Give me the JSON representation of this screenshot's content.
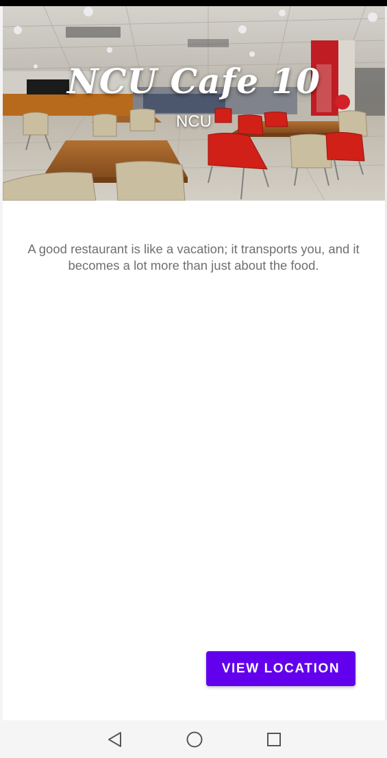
{
  "hero": {
    "title": "NCU Cafe 10",
    "subtitle": "NCU",
    "image_icon": "cafeteria-photo"
  },
  "description": "A good restaurant is like a vacation; it transports you, and it becomes a lot more than just about the food.",
  "actions": {
    "view_location_label": "VIEW LOCATION"
  },
  "navigation": {
    "back_icon": "back-triangle-icon",
    "home_icon": "home-circle-icon",
    "recents_icon": "recents-square-icon"
  },
  "colors": {
    "accent": "#6200ee",
    "description_text": "#6f6f6f",
    "nav_bar": "#f5f5f5"
  }
}
